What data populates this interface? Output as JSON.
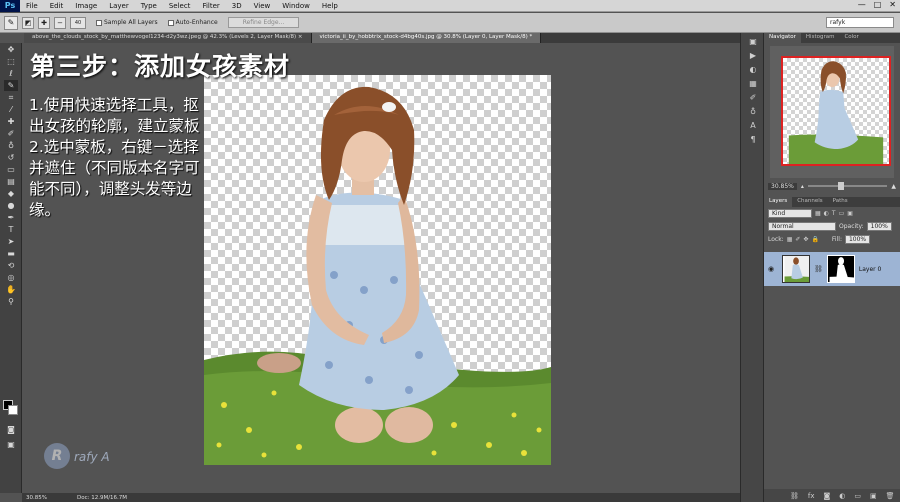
{
  "menubar": {
    "logo": "Ps",
    "items": [
      "File",
      "Edit",
      "Image",
      "Layer",
      "Type",
      "Select",
      "Filter",
      "3D",
      "View",
      "Window",
      "Help"
    ],
    "win_min": "—",
    "win_max": "□",
    "win_close": "✕"
  },
  "options": {
    "brush_size": "40",
    "sample_all_layers": "Sample All Layers",
    "auto_enhance": "Auto-Enhance",
    "refine_edge": "Refine Edge...",
    "workspace": "rafyk"
  },
  "tabs": [
    "above_the_clouds_stock_by_matthewvogel1234-d2y3wz.jpeg @ 42.3% (Levels 2, Layer Mask/8) ×",
    "victoria_ii_by_hobbtrix_stock-d4bg40s.jpg @ 30.8% (Layer 0, Layer Mask/8) *"
  ],
  "tutorial": {
    "title": "第三步：添加女孩素材",
    "body": "1.使用快速选择工具，抠出女孩的轮廓，建立蒙板 2.选中蒙板，右键－选择并遮住（不同版本名字可能不同），调整头发等边缘。"
  },
  "watermark": {
    "logo": "R",
    "text": "rafy A"
  },
  "status": {
    "zoom": "30.85%",
    "doc": "Doc: 12.9M/16.7M"
  },
  "panels": {
    "navigator_tabs": [
      "Navigator",
      "Histogram",
      "Color"
    ],
    "zoom": "30.85%",
    "layers_tabs": [
      "Layers",
      "Channels",
      "Paths"
    ],
    "kind": "Kind",
    "blend_mode": "Normal",
    "opacity_label": "Opacity:",
    "opacity": "100%",
    "lock_label": "Lock:",
    "fill_label": "Fill:",
    "fill": "100%",
    "layer_name": "Layer 0"
  }
}
